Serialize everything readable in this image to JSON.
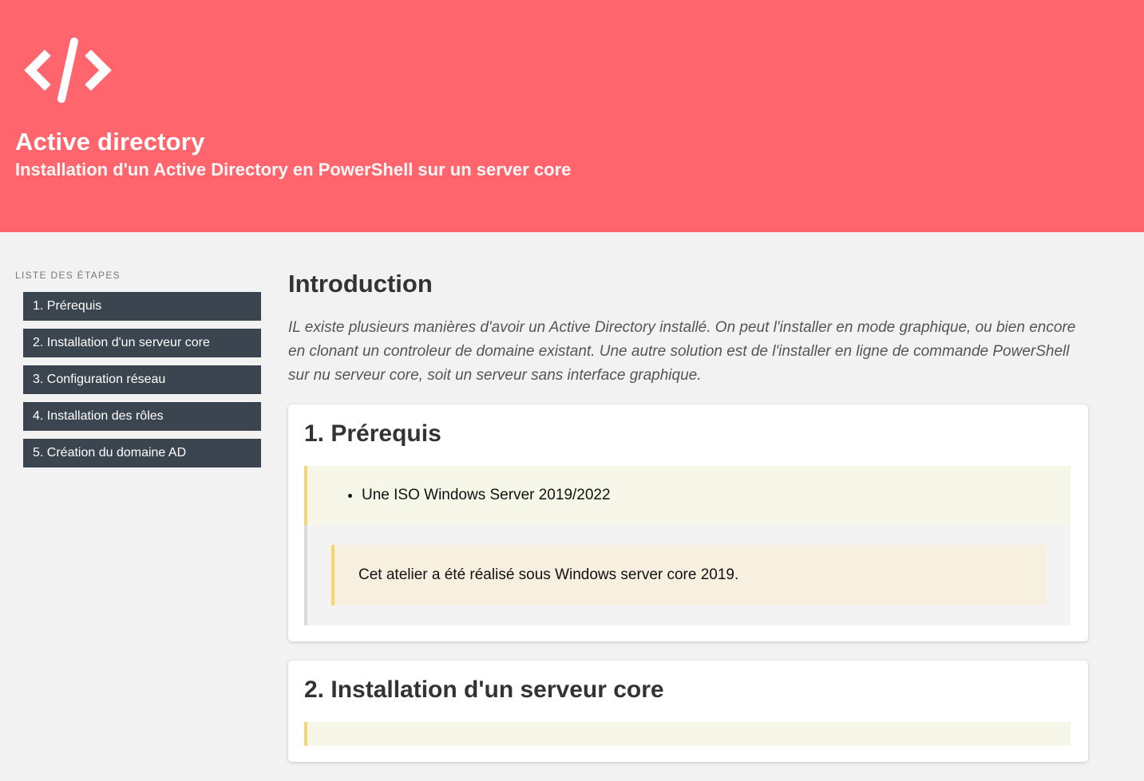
{
  "header": {
    "logo_icon": "code-brackets-icon",
    "title": "Active directory",
    "subtitle": "Installation d'un Active Directory en PowerShell sur un server core"
  },
  "sidebar": {
    "heading": "Liste des étapes",
    "items": [
      {
        "label": "1. Prérequis"
      },
      {
        "label": "2. Installation d'un serveur core"
      },
      {
        "label": "3. Configuration réseau"
      },
      {
        "label": "4. Installation des rôles"
      },
      {
        "label": "5. Création du domaine AD"
      }
    ]
  },
  "main": {
    "title": "Introduction",
    "intro": "IL existe plusieurs manières d'avoir un Active Directory installé. On peut l'installer en mode graphique, ou bien encore en clonant un controleur de domaine existant. Une autre solution est de l'installer en ligne de commande PowerShell sur nu serveur core, soit un serveur sans interface graphique.",
    "sections": [
      {
        "title": "1. Prérequis",
        "bullets": [
          "Une ISO Windows Server 2019/2022"
        ],
        "note": "Cet atelier a été réalisé sous Windows server core 2019."
      },
      {
        "title": "2. Installation d'un serveur core"
      }
    ]
  },
  "colors": {
    "header_bg": "#ff656c",
    "sidebar_item_bg": "#3a4550",
    "accent_border": "#f5d76e"
  }
}
